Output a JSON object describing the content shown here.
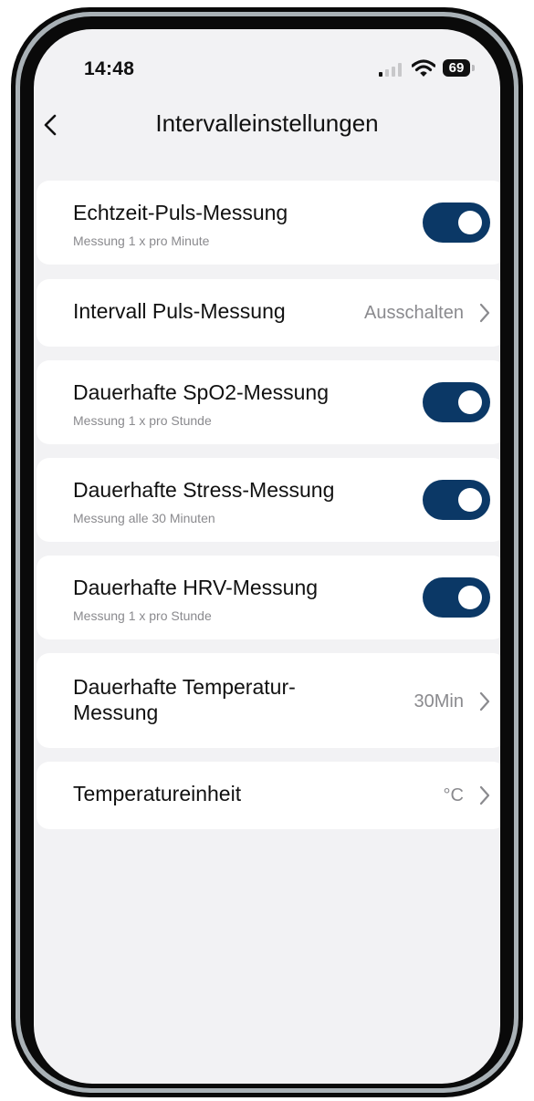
{
  "status_bar": {
    "time": "14:48",
    "battery": "69",
    "icons": [
      "signal-icon",
      "wifi-icon",
      "battery-icon"
    ]
  },
  "header": {
    "title": "Intervalleinstellungen",
    "back_icon": "chevron-left-icon"
  },
  "colors": {
    "toggle_on": "#0b3866",
    "background": "#f2f2f4",
    "secondary_text": "#8a8a8e"
  },
  "settings": {
    "realtime_pulse": {
      "label": "Echtzeit-Puls-Messung",
      "sub": "Messung 1 x pro Minute",
      "enabled": true
    },
    "interval_pulse": {
      "label": "Intervall Puls-Messung",
      "value": "Ausschalten"
    },
    "spo2": {
      "label": "Dauerhafte SpO2-Messung",
      "sub": "Messung  1 x pro Stunde",
      "enabled": true
    },
    "stress": {
      "label": "Dauerhafte Stress-Messung",
      "sub": "Messung alle 30 Minuten",
      "enabled": true
    },
    "hrv": {
      "label": "Dauerhafte HRV-Messung",
      "sub": "Messung  1 x pro Stunde",
      "enabled": true
    },
    "temperature": {
      "label_line1": "Dauerhafte Temperatur-",
      "label_line2": "Messung",
      "value": "30Min"
    },
    "temp_unit": {
      "label": "Temperatureinheit",
      "value": "°C"
    }
  }
}
